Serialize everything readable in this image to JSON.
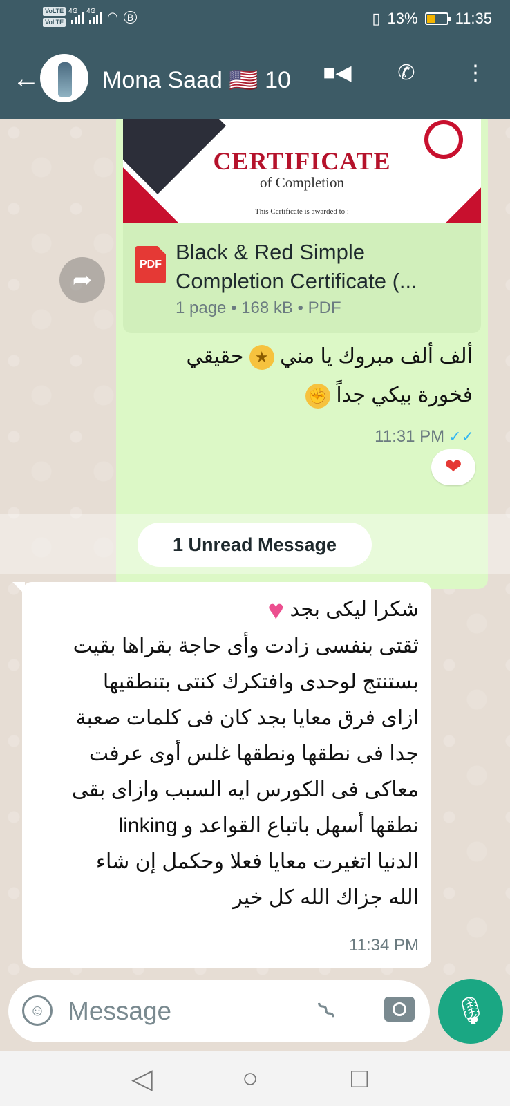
{
  "status": {
    "net1": "4G",
    "net2": "4G",
    "battery": "13%",
    "time": "11:35",
    "volte1": "VoLTE",
    "volte2": "VoLTE"
  },
  "header": {
    "contact": "Mona Saad 🇺🇸 10"
  },
  "outgoing": {
    "certificate": {
      "title": "CERTIFICATE",
      "subtitle": "of Completion",
      "awarded": "This Certificate is awarded to :"
    },
    "pdf_label": "PDF",
    "doc_name_line1": "Black & Red Simple",
    "doc_name_line2": "Completion Certificate (...",
    "doc_meta": "1 page • 168 kB • PDF",
    "text_line1": "ألف ألف مبروك يا مني",
    "text_line1b": "حقيقي",
    "text_line2": "فخورة بيكي جداً",
    "time": "11:31 PM",
    "reaction": "❤"
  },
  "unread_label": "1 Unread Message",
  "incoming": {
    "line0": "شكرا ليكى بجد",
    "body": [
      "ثقتى بنفسى زادت وأى حاجة بقراها بقيت",
      "بستنتج لوحدى وافتكرك كنتى بتنطقيها",
      "ازاى  فرق معايا بجد كان فى كلمات صعبة",
      "جدا فى نطقها ونطقها غلس أوى عرفت",
      "معاكى فى الكورس ايه السبب وازاى بقى",
      "نطقها أسهل باتباع القواعد و linking",
      "الدنيا اتغيرت معايا فعلا وحكمل إن شاء",
      "الله جزاك الله كل خير"
    ],
    "time": "11:34 PM"
  },
  "composer": {
    "placeholder": "Message"
  },
  "icons": {
    "back": "arrow-left-icon",
    "video": "video-call-icon",
    "phone": "phone-icon",
    "menu": "more-vert-icon",
    "forward": "forward-icon",
    "emoji": "emoji-icon",
    "attach": "paperclip-icon",
    "camera": "camera-icon",
    "mic": "mic-icon"
  },
  "colors": {
    "header": "#3d5b66",
    "outgoing": "#dcf8c6",
    "accent": "#1aa783",
    "read_ticks": "#34b7f1"
  }
}
